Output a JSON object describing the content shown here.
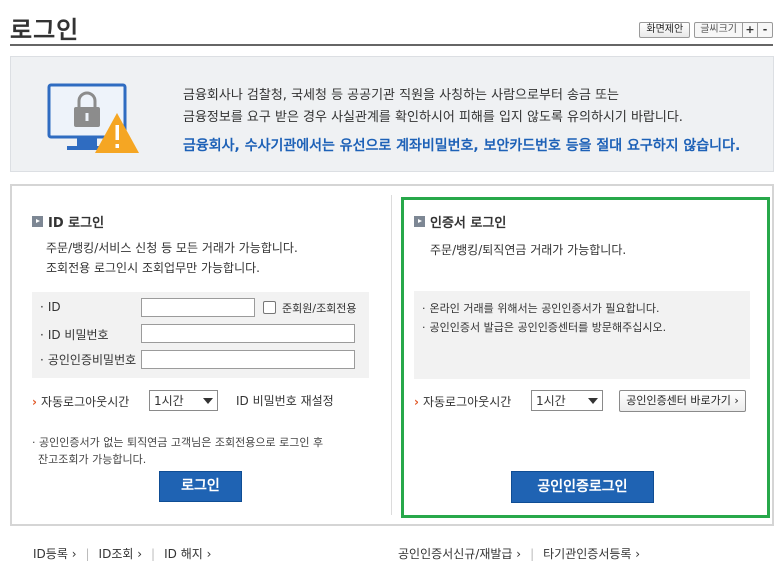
{
  "page": {
    "title": "로그인"
  },
  "tools": {
    "suggest": "화면제안",
    "font_size": "글씨크기",
    "plus": "+",
    "minus": "-"
  },
  "notice": {
    "line1": "금융회사나 검찰청, 국세청 등 공공기관 직원을 사칭하는 사람으로부터 송금 또는",
    "line2": "금융정보를 요구 받은 경우 사실관계를 확인하시어 피해를 입지 않도록 유의하시기 바랍니다.",
    "line3": "금융회사, 수사기관에서는 유선으로 계좌비밀번호, 보안카드번호 등을 절대 요구하지 않습니다."
  },
  "id_login": {
    "title": "ID 로그인",
    "desc1": "주문/뱅킹/서비스 신청 등 모든 거래가 가능합니다.",
    "desc2": "조회전용 로그인시 조회업무만 가능합니다.",
    "id_label": "ID",
    "id_value": "",
    "semi_member": "준회원/조회전용",
    "pw_label": "ID 비밀번호",
    "pw_value": "",
    "cert_pw_label": "공인인증비밀번호",
    "cert_pw_value": "",
    "auto_logout_label": "자동로그아웃시간",
    "auto_logout_value": "1시간",
    "reset_pw": "ID 비밀번호 재설정",
    "note1": "· 공인인증서가 없는 퇴직연금 고객님은 조회전용으로 로그인 후",
    "note2": "잔고조회가 가능합니다.",
    "login_button": "로그인"
  },
  "cert_login": {
    "title": "인증서 로그인",
    "desc": "주문/뱅킹/퇴직연금 거래가 가능합니다.",
    "info1": "온라인 거래를 위해서는 공인인증서가 필요합니다.",
    "info2": "공인인증서 발급은 공인인증센터를 방문해주십시오.",
    "auto_logout_label": "자동로그아웃시간",
    "auto_logout_value": "1시간",
    "center_button": "공인인증센터 바로가기 ›",
    "login_button": "공인인증로그인"
  },
  "footer": {
    "id_register": "ID등록",
    "id_lookup": "ID조회",
    "id_cancel": "ID 해지",
    "cert_issue": "공인인증서신규/재발급",
    "other_cert": "타기관인증서등록"
  },
  "colors": {
    "accent_blue": "#1f63b3",
    "highlight_green": "#27a84a",
    "warning_yellow": "#f5a623"
  },
  "icons": {
    "notice": "monitor-lock-warning-icon"
  }
}
